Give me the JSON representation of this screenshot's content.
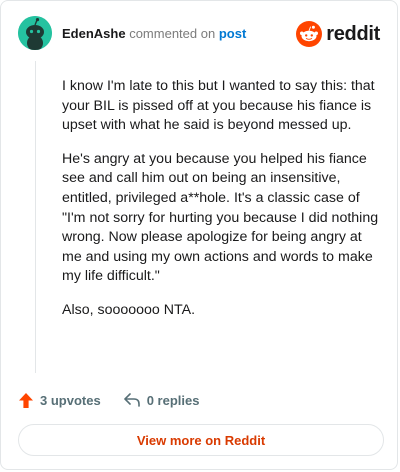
{
  "comment": {
    "author": "EdenAshe",
    "commented_on_text": "commented on",
    "post_link": "post",
    "paragraphs": [
      "I know I'm late to this but I wanted to say this: that your BIL is pissed off at you because his fiance is upset with what he said is beyond messed up.",
      "He's angry at you because you helped his fiance see and call him out on being an insensitive, entitled, privileged a**hole. It's a classic case of \"I'm not sorry for hurting you because I did nothing wrong. Now please apologize for being angry at me and using my own actions and words to make my life difficult.\"",
      "Also, sooooooo NTA."
    ],
    "upvotes": "3 upvotes",
    "replies": "0 replies"
  },
  "brand": {
    "wordmark": "reddit",
    "icon": "reddit-snoo-icon",
    "color": "#ff4500"
  },
  "avatar": {
    "icon": "snoo-avatar-icon",
    "background": "#25c2a0"
  },
  "footer": {
    "view_more_label": "View more on Reddit"
  },
  "colors": {
    "upvote": "#ff4500",
    "link": "#0079d3",
    "view_more": "#d93a00"
  }
}
